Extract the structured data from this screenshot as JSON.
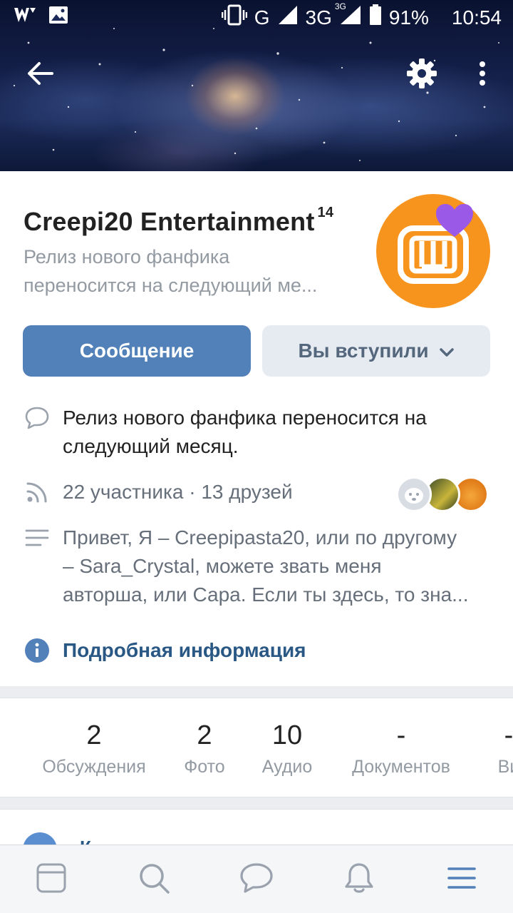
{
  "status_bar": {
    "signal_label": "G",
    "network_label": "3G",
    "network_superscript": "3G",
    "battery": "91%",
    "time": "10:54",
    "icons": [
      "wattpad-icon",
      "image-icon",
      "vibrate-icon",
      "signal-icon",
      "battery-icon"
    ]
  },
  "header": {
    "back_icon": "arrow-left-icon",
    "settings_icon": "gear-icon",
    "more_icon": "more-vertical-icon"
  },
  "group": {
    "name": "Creepi20 Entertainment",
    "age_rating": "14",
    "status_line1": "Релиз нового фанфика",
    "status_line2": "переносится на следующий ме...",
    "avatar_icon": "wattpad-logo-icon"
  },
  "actions": {
    "message_label": "Сообщение",
    "joined_label": "Вы вступили"
  },
  "info": {
    "status_full_line1": "Релиз нового фанфика переносится на",
    "status_full_line2": "следующий месяц.",
    "members": "22 участника · 13 друзей",
    "description_line1": "Привет, Я – Creepipasta20, или по другому",
    "description_line2": "– Sara_Crystal, можете звать меня",
    "description_line3": "авторша, или Сара. Если ты здесь, то зна...",
    "details_link": "Подробная информация"
  },
  "counters": [
    {
      "num": "2",
      "label": "Обсуждения"
    },
    {
      "num": "2",
      "label": "Фото"
    },
    {
      "num": "10",
      "label": "Аудио"
    },
    {
      "num": "-",
      "label": "Документов"
    },
    {
      "num": "-",
      "label": "Ви"
    }
  ],
  "next_card": {
    "partial_text": "К"
  },
  "bottom_nav": [
    "news-icon",
    "search-icon",
    "messages-icon",
    "notifications-icon",
    "menu-icon"
  ],
  "colors": {
    "primary": "#5181b8",
    "secondary_btn": "#e5ebf1",
    "link": "#2a5885",
    "avatar_bg": "#f7941e",
    "heart": "#9b59e8"
  }
}
